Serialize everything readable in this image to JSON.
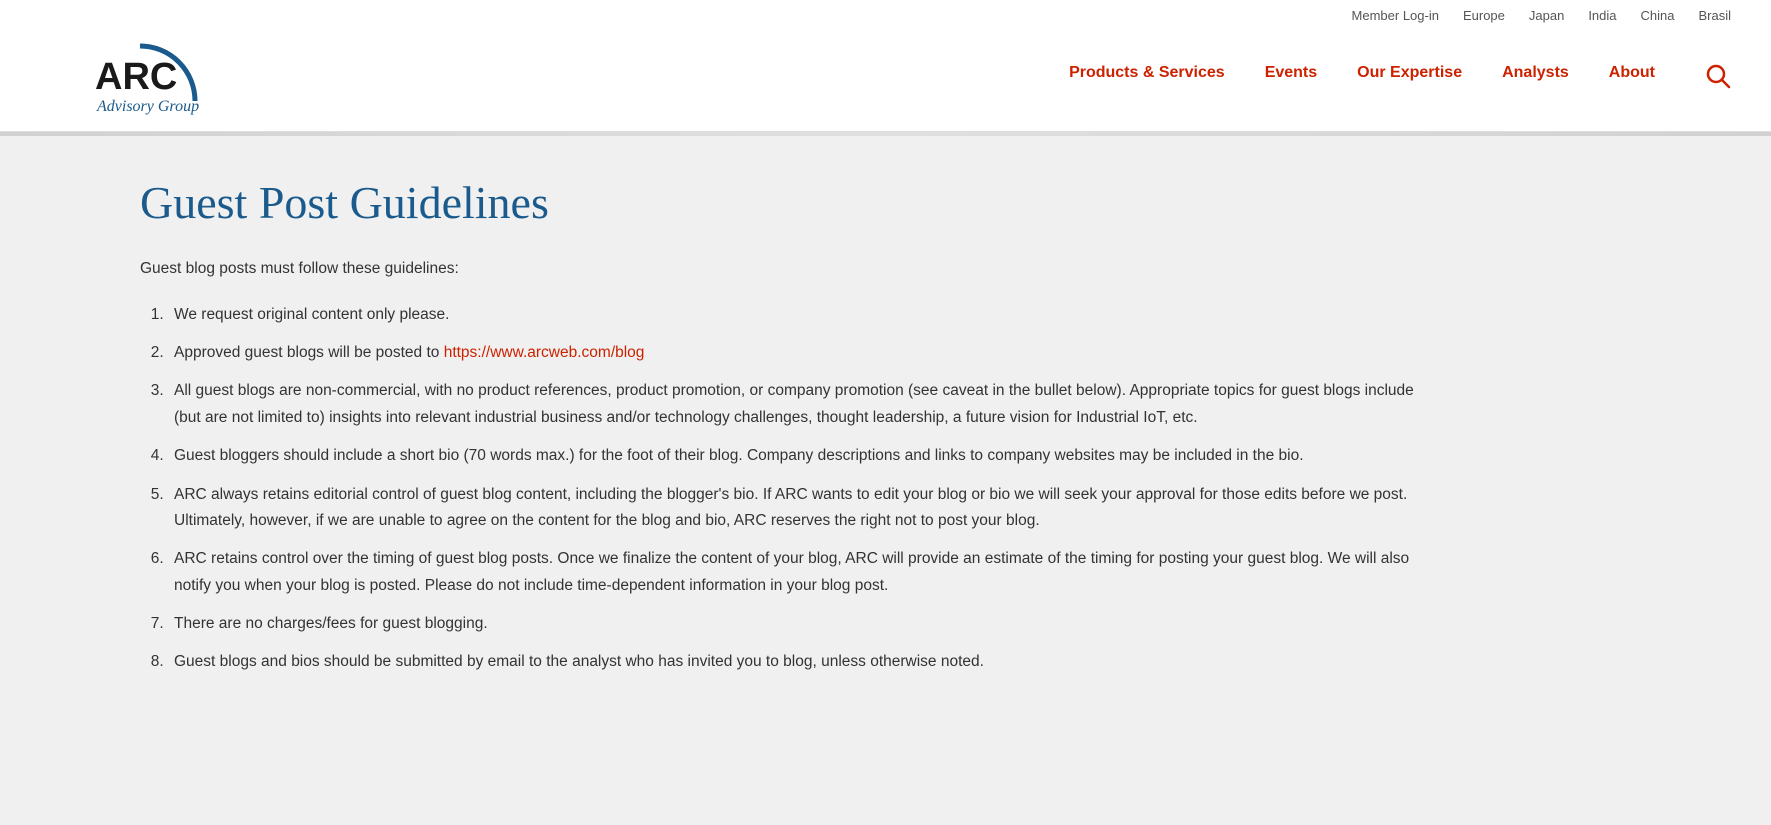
{
  "topbar": {
    "links": [
      {
        "label": "Member Log-in",
        "href": "#"
      },
      {
        "label": "Europe",
        "href": "#"
      },
      {
        "label": "Japan",
        "href": "#"
      },
      {
        "label": "India",
        "href": "#"
      },
      {
        "label": "China",
        "href": "#"
      },
      {
        "label": "Brasil",
        "href": "#"
      }
    ]
  },
  "nav": {
    "items": [
      {
        "label": "Products & Services",
        "href": "#"
      },
      {
        "label": "Events",
        "href": "#"
      },
      {
        "label": "Our Expertise",
        "href": "#"
      },
      {
        "label": "Analysts",
        "href": "#"
      },
      {
        "label": "About",
        "href": "#"
      }
    ],
    "search_aria": "Search"
  },
  "logo": {
    "arc_text": "ARC",
    "advisory_text": "Advisory Group"
  },
  "content": {
    "page_title": "Guest Post Guidelines",
    "intro": "Guest blog posts must follow these guidelines:",
    "guidelines": [
      {
        "text": "We request original content only please.",
        "link": null,
        "link_text": null
      },
      {
        "text_before": "Approved guest blogs will be posted to ",
        "link": "https://www.arcweb.com/blog",
        "link_text": "https://www.arcweb.com/blog",
        "text_after": ""
      },
      {
        "text": "All guest blogs are non-commercial, with no product references, product promotion, or company promotion (see caveat in the bullet below). Appropriate topics for guest blogs include (but are not limited to) insights into relevant industrial business and/or technology challenges, thought leadership, a future vision for Industrial IoT, etc.",
        "link": null
      },
      {
        "text": "Guest bloggers should include a short bio (70 words max.) for the foot of their blog.  Company descriptions and links to company websites may be included in the bio.",
        "link": null
      },
      {
        "text": "ARC always retains editorial control of guest blog content, including the blogger's bio.  If ARC wants to edit your blog or bio we will seek your approval for those edits before we post.  Ultimately, however, if we are unable to agree on the content for the blog and bio, ARC reserves the right not to post your blog.",
        "link": null
      },
      {
        "text": "ARC retains control over the timing of guest blog posts.  Once we finalize the content of your blog, ARC will provide an estimate of the timing for posting your guest blog.  We will also notify you when your blog is posted.  Please do not include time-dependent information in your blog post.",
        "link": null
      },
      {
        "text": "There are no charges/fees for guest blogging.",
        "link": null
      },
      {
        "text": "Guest blogs and bios should be submitted by email to the analyst who has invited you to blog, unless otherwise noted.",
        "link": null
      }
    ]
  }
}
